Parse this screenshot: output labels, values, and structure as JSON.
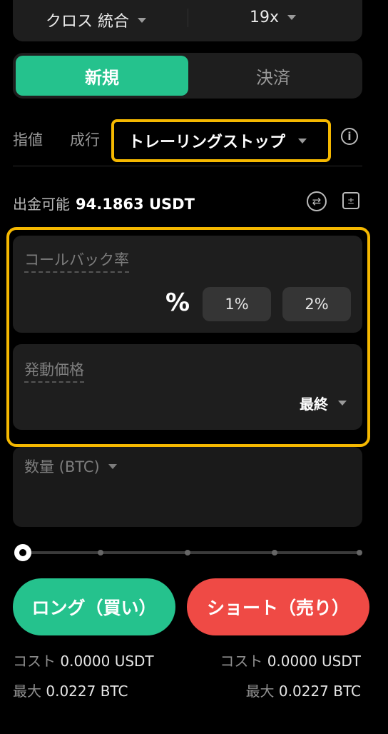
{
  "top": {
    "margin_mode": "クロス 統合",
    "leverage": "19x"
  },
  "tabs": {
    "open": "新規",
    "close": "決済"
  },
  "order_types": {
    "limit": "指値",
    "market": "成行",
    "trailing": "トレーリングストップ"
  },
  "available": {
    "label": "出金可能",
    "value": "94.1863 USDT"
  },
  "callback": {
    "label": "コールバック率",
    "unit": "%",
    "chip1": "1%",
    "chip2": "2%"
  },
  "trigger": {
    "label": "発動価格",
    "price_type": "最終"
  },
  "quantity": {
    "label": "数量 (BTC)"
  },
  "actions": {
    "long": "ロング（買い）",
    "short": "ショート（売り）"
  },
  "long_info": {
    "cost_label": "コスト",
    "cost_value": "0.0000 USDT",
    "max_label": "最大",
    "max_value": "0.0227 BTC"
  },
  "short_info": {
    "cost_label": "コスト",
    "cost_value": "0.0000 USDT",
    "max_label": "最大",
    "max_value": "0.0227 BTC"
  },
  "colors": {
    "accent_green": "#25c28d",
    "accent_red": "#ef4a45",
    "highlight": "#f5b800"
  },
  "icons": {
    "info": "info-icon",
    "swap": "swap-icon",
    "calculator": "calculator-icon"
  }
}
